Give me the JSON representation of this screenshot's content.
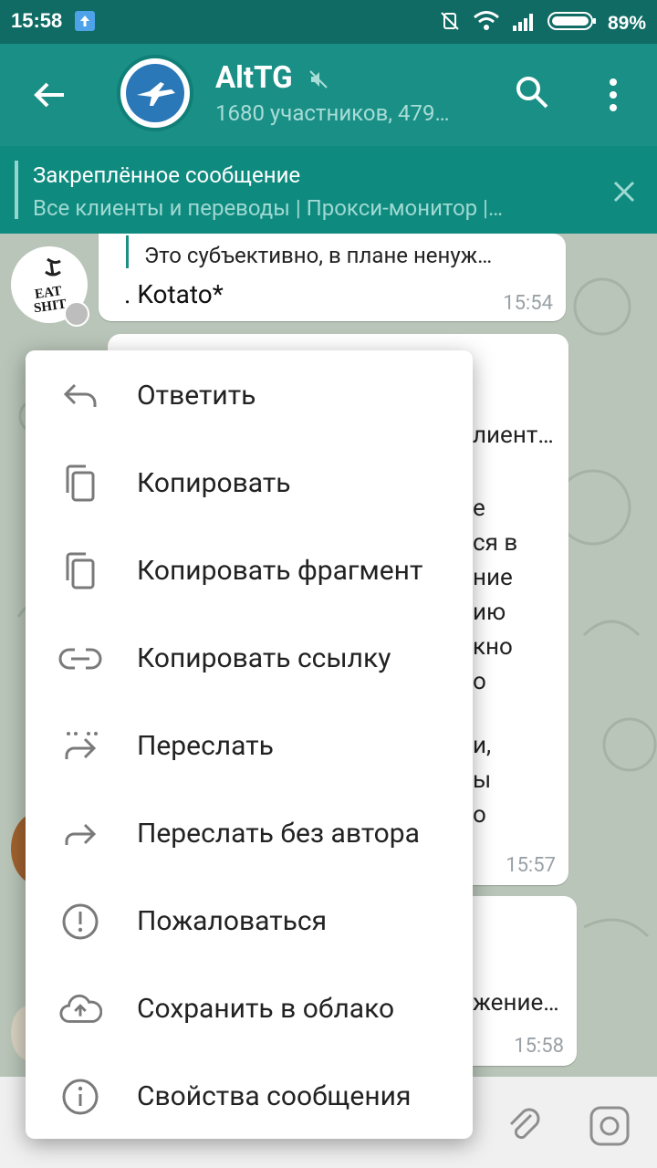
{
  "statusbar": {
    "time": "15:58",
    "battery": "89%"
  },
  "header": {
    "title": "AltTG",
    "subtitle": "1680 участников, 479…"
  },
  "pinned": {
    "label": "Закреплённое сообщение",
    "text": "Все клиенты и переводы | Прокси-монитор |…"
  },
  "messages": [
    {
      "reply_preview": "Это субъективно, в плане ненуж…",
      "text": ". Kotato*",
      "time": "15:54"
    },
    {
      "partial_lines": [
        "лиент…",
        "е",
        "ся в",
        "ние",
        "ию",
        "кно",
        "о",
        "и,",
        "ы",
        "о"
      ],
      "time": "15:57"
    },
    {
      "partial_lines": [
        "жение…"
      ],
      "time": "15:58"
    }
  ],
  "avatar_text": "EAT SHIT",
  "context_menu": {
    "items": [
      {
        "label": "Ответить",
        "icon": "reply-icon"
      },
      {
        "label": "Копировать",
        "icon": "copy-icon"
      },
      {
        "label": "Копировать фрагмент",
        "icon": "copy-fragment-icon"
      },
      {
        "label": "Копировать ссылку",
        "icon": "link-icon"
      },
      {
        "label": "Переслать",
        "icon": "forward-icon"
      },
      {
        "label": "Переслать без автора",
        "icon": "forward-no-author-icon"
      },
      {
        "label": "Пожаловаться",
        "icon": "report-icon"
      },
      {
        "label": "Сохранить в облако",
        "icon": "cloud-upload-icon"
      },
      {
        "label": "Свойства сообщения",
        "icon": "info-icon"
      }
    ]
  },
  "colors": {
    "header": "#1a8f86",
    "statusbar": "#0f6b64",
    "pinned": "#0f8a7f",
    "accent": "#1a8f86"
  }
}
